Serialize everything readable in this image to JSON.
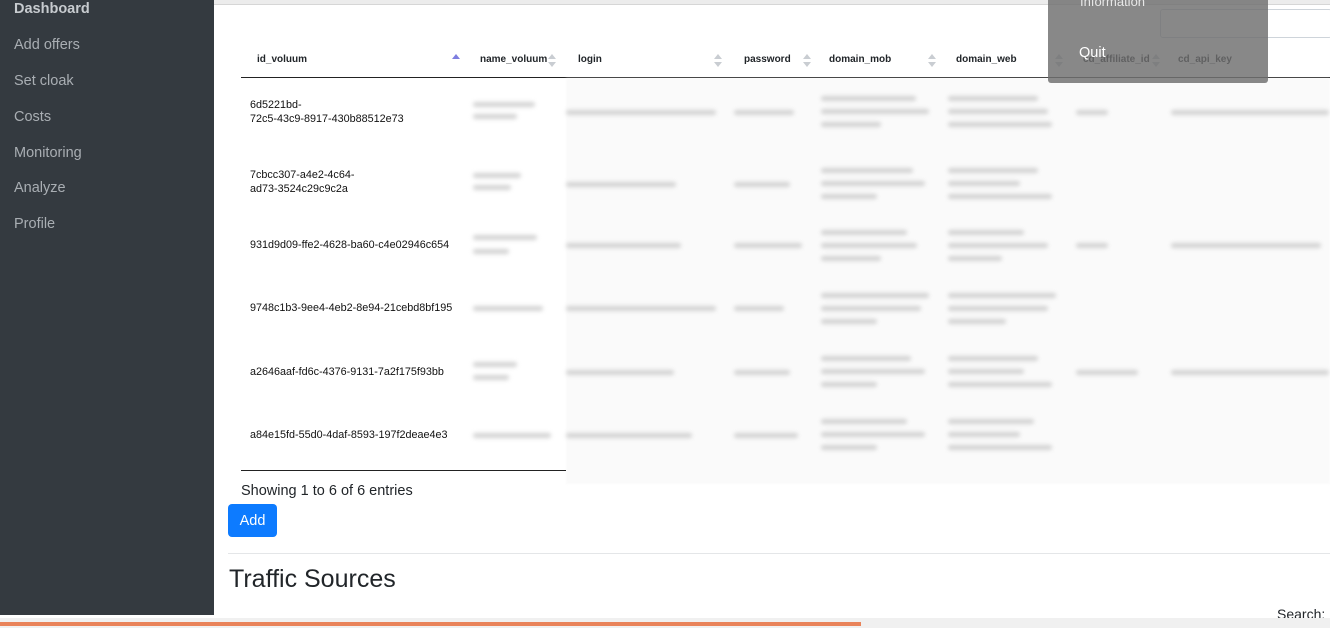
{
  "sidebar": {
    "items": [
      {
        "label": "Dashboard",
        "active": true
      },
      {
        "label": "Add offers"
      },
      {
        "label": "Set cloak"
      },
      {
        "label": "Costs"
      },
      {
        "label": "Monitoring"
      },
      {
        "label": "Analyze"
      },
      {
        "label": "Profile"
      }
    ]
  },
  "table": {
    "columns": [
      "id_voluum",
      "name_voluum",
      "login",
      "password",
      "domain_mob",
      "domain_web",
      "cd_affiliate_id",
      "cd_api_key"
    ],
    "sorted_column": "id_voluum",
    "sort_direction": "ascending",
    "rows": [
      {
        "id_voluum_line1": "6d5221bd-",
        "id_voluum_line2": "72c5-43c9-8917-430b88512e73"
      },
      {
        "id_voluum_line1": "7cbcc307-a4e2-4c64-",
        "id_voluum_line2": "ad73-3524c29c9c2a"
      },
      {
        "id_voluum_line1": "931d9d09-ffe2-4628-ba60-c4e02946c654",
        "id_voluum_line2": ""
      },
      {
        "id_voluum_line1": "9748c1b3-9ee4-4eb2-8e94-21cebd8bf195",
        "id_voluum_line2": ""
      },
      {
        "id_voluum_line1": "a2646aaf-fd6c-4376-9131-7a2f175f93bb",
        "id_voluum_line2": ""
      },
      {
        "id_voluum_line1": "a84e15fd-55d0-4daf-8593-197f2deae4e3",
        "id_voluum_line2": ""
      }
    ],
    "info": "Showing 1 to 6 of 6 entries"
  },
  "actions": {
    "add_label": "Add"
  },
  "traffic_sources": {
    "title": "Traffic Sources",
    "search_label": "Search:"
  },
  "user_menu": {
    "partial_item": "Information",
    "quit_label": "Quit"
  },
  "page_load_progress": 0.647,
  "colors": {
    "sidebar_bg": "#343a40",
    "primary": "#0d7bff",
    "progress": "#e9835a",
    "sort_active": "#7e7ee0"
  }
}
